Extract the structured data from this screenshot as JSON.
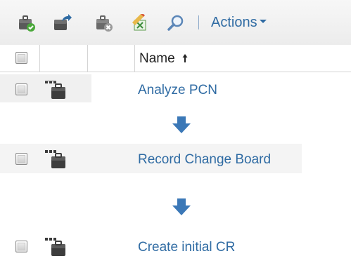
{
  "toolbar": {
    "buttons": [
      {
        "name": "approve",
        "icon": "briefcase-check-icon"
      },
      {
        "name": "export",
        "icon": "briefcase-arrow-icon"
      },
      {
        "name": "remove",
        "icon": "briefcase-x-icon"
      },
      {
        "name": "export-excel",
        "icon": "excel-edit-icon"
      },
      {
        "name": "search",
        "icon": "magnifier-icon"
      }
    ],
    "actions_label": "Actions"
  },
  "table": {
    "columns": {
      "name": "Name"
    },
    "sort": {
      "column": "Name",
      "direction": "ascending"
    },
    "rows": [
      {
        "name": "Analyze PCN"
      },
      {
        "name": "Record Change Board"
      },
      {
        "name": "Create initial CR"
      }
    ]
  },
  "colors": {
    "link": "#2f6ba3",
    "flow_arrow": "#3b78b7"
  }
}
